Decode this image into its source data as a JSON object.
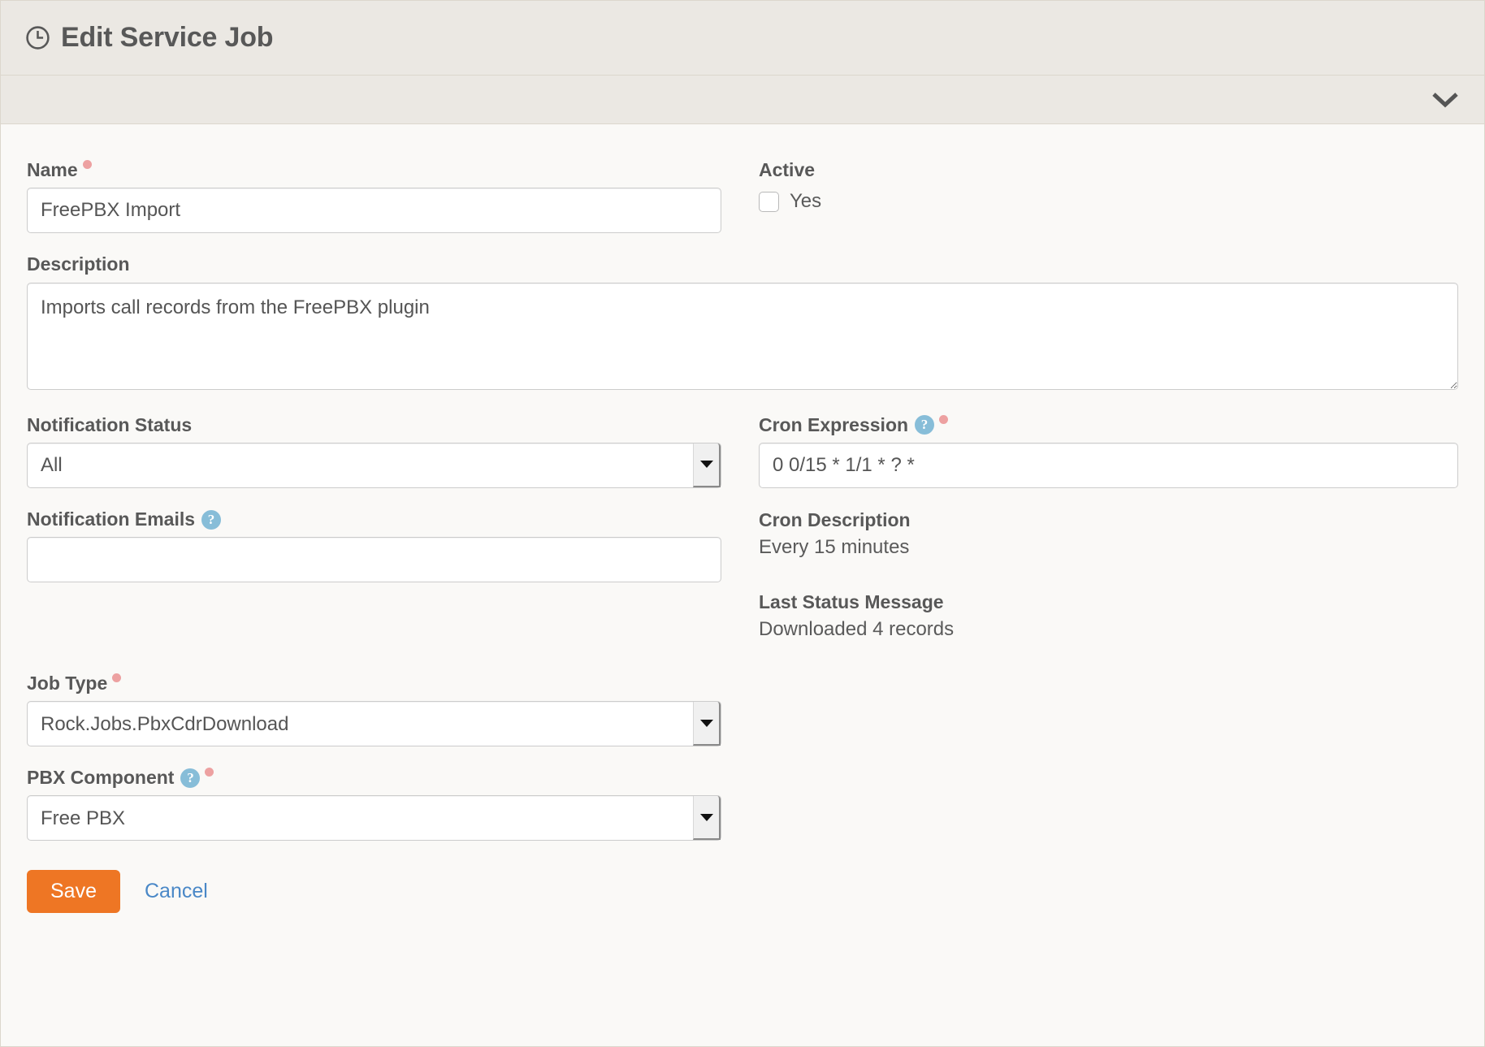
{
  "panel": {
    "title": "Edit Service Job",
    "title_icon": "clock-icon",
    "collapse_icon": "chevron-down-icon"
  },
  "form": {
    "name": {
      "label": "Name",
      "required": true,
      "value": "FreePBX Import",
      "placeholder": ""
    },
    "active": {
      "label": "Active",
      "checkbox_label": "Yes",
      "checked": false
    },
    "description": {
      "label": "Description",
      "value": "Imports call records from the FreePBX plugin",
      "placeholder": ""
    },
    "notification_status": {
      "label": "Notification Status",
      "value": "All",
      "options": [
        "All"
      ]
    },
    "notification_emails": {
      "label": "Notification Emails",
      "help_icon": "question-circle-icon",
      "value": "",
      "placeholder": ""
    },
    "job_type": {
      "label": "Job Type",
      "required": true,
      "value": "Rock.Jobs.PbxCdrDownload",
      "options": [
        "Rock.Jobs.PbxCdrDownload"
      ]
    },
    "pbx_component": {
      "label": "PBX Component",
      "help_icon": "question-circle-icon",
      "required": true,
      "value": "Free PBX",
      "options": [
        "Free PBX"
      ]
    },
    "cron_expression": {
      "label": "Cron Expression",
      "help_icon": "question-circle-icon",
      "required": true,
      "value": "0 0/15 * 1/1 * ? *",
      "placeholder": ""
    },
    "cron_description": {
      "label": "Cron Description",
      "value": "Every 15 minutes"
    },
    "last_status_message": {
      "label": "Last Status Message",
      "value": "Downloaded 4 records"
    }
  },
  "actions": {
    "save_label": "Save",
    "cancel_label": "Cancel"
  },
  "colors": {
    "header_bg": "#ebe8e3",
    "body_bg": "#faf9f7",
    "border": "#dcd7cd",
    "primary_button": "#ee7624",
    "link": "#4a88c7",
    "help_icon": "#87bdd8",
    "required_dot": "#eda1a1",
    "text": "#585858"
  }
}
